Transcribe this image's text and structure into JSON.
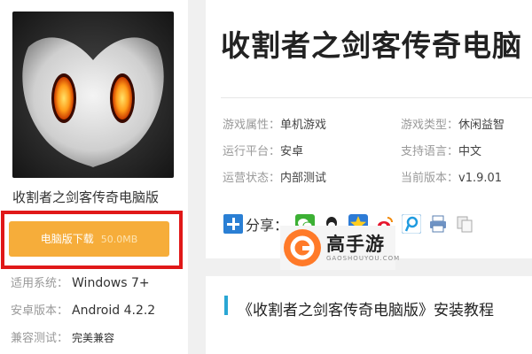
{
  "app": {
    "name": "收割者之剑客传奇电脑版",
    "download_label": "电脑版下载",
    "download_size": "50.0MB",
    "meta": [
      {
        "label": "适用系统：",
        "value": "Windows 7+"
      },
      {
        "label": "安卓版本：",
        "value": "Android 4.2.2"
      },
      {
        "label": "兼容测试：",
        "value": "完美兼容"
      }
    ]
  },
  "detail": {
    "title": "收割者之剑客传奇电脑",
    "attributes": [
      {
        "label": "游戏属性：",
        "value": "单机游戏"
      },
      {
        "label": "游戏类型：",
        "value": "休闲益智"
      },
      {
        "label": "运行平台：",
        "value": "安卓"
      },
      {
        "label": "支持语言：",
        "value": "中文"
      },
      {
        "label": "运营状态：",
        "value": "内部测试"
      },
      {
        "label": "当前版本：",
        "value": "v1.9.01"
      }
    ],
    "share_label": "分享：",
    "share_icons": [
      "wechat-icon",
      "qq-icon",
      "qzone-icon",
      "weibo-icon",
      "tencent-weibo-icon",
      "print-icon",
      "copy-icon"
    ]
  },
  "brand": {
    "name": "高手游",
    "domain": "GAOSHOUYOU.COM"
  },
  "section": {
    "title": "《收割者之剑客传奇电脑版》安装教程"
  },
  "colors": {
    "download_button": "#f6ad3a",
    "highlight_border": "#e01818",
    "accent_blue": "#2aa7d4"
  }
}
